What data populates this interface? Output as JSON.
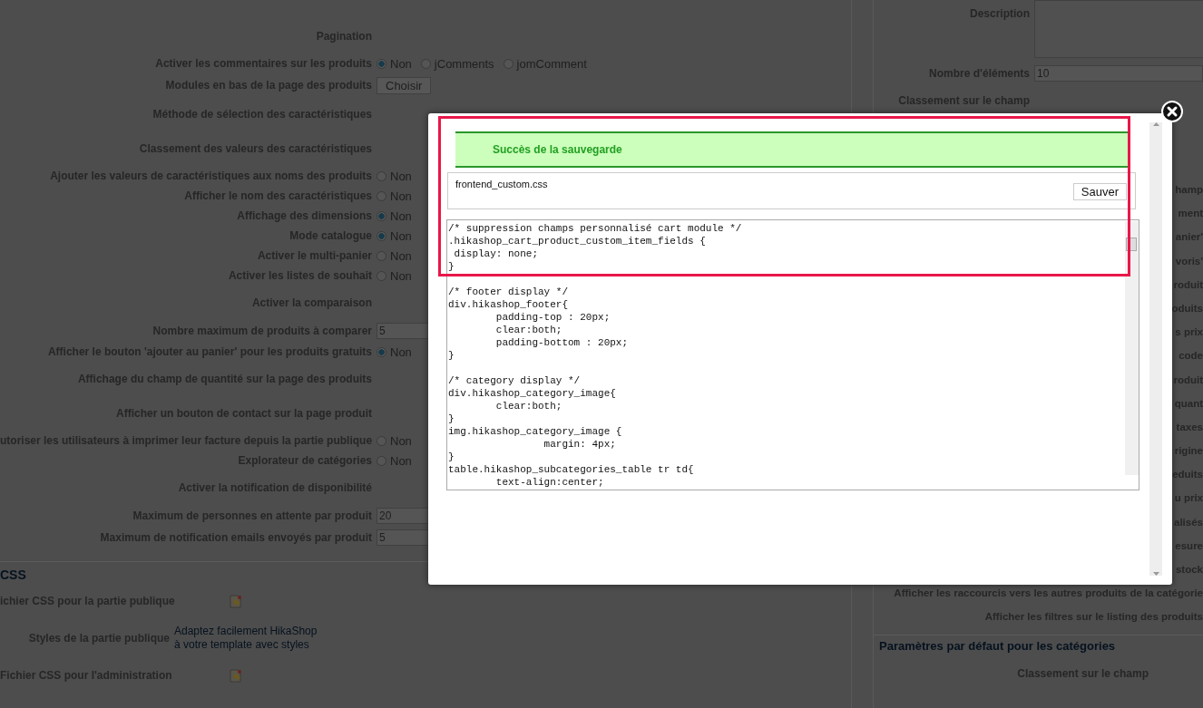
{
  "settings_left": {
    "rows": [
      {
        "label": "Pagination",
        "kind": "none"
      },
      {
        "label": "Activer les commentaires sur les produits",
        "kind": "radio",
        "options": [
          {
            "label": "Non",
            "selected": true
          },
          {
            "label": "jComments",
            "selected": false
          },
          {
            "label": "jomComment",
            "selected": false
          }
        ]
      },
      {
        "label": "Modules en bas de la page des produits",
        "kind": "button",
        "button": "Choisir"
      },
      {
        "label": "Méthode de sélection des caractéristiques",
        "kind": "none"
      },
      {
        "label": "Classement des valeurs des caractéristiques",
        "kind": "none"
      },
      {
        "label": "Ajouter les valeurs de caractéristiques aux noms des produits",
        "kind": "radio",
        "options": [
          {
            "label": "Non",
            "selected": false
          }
        ]
      },
      {
        "label": "Afficher le nom des caractéristiques",
        "kind": "radio",
        "options": [
          {
            "label": "Non",
            "selected": false
          }
        ]
      },
      {
        "label": "Affichage des dimensions",
        "kind": "radio",
        "options": [
          {
            "label": "Non",
            "selected": true
          }
        ]
      },
      {
        "label": "Mode catalogue",
        "kind": "radio",
        "options": [
          {
            "label": "Non",
            "selected": true
          }
        ]
      },
      {
        "label": "Activer le multi-panier",
        "kind": "radio",
        "options": [
          {
            "label": "Non",
            "selected": false
          }
        ]
      },
      {
        "label": "Activer les listes de souhait",
        "kind": "radio",
        "options": [
          {
            "label": "Non",
            "selected": false
          }
        ]
      },
      {
        "label": "Activer la comparaison",
        "kind": "none"
      },
      {
        "label": "Nombre maximum de produits à comparer",
        "kind": "input",
        "value": "5"
      },
      {
        "label": "Afficher le bouton 'ajouter au panier' pour les produits gratuits",
        "kind": "radio",
        "options": [
          {
            "label": "Non",
            "selected": true
          }
        ]
      },
      {
        "label": "Affichage du champ de quantité sur la page des produits",
        "kind": "none"
      },
      {
        "label": "Afficher un bouton de contact sur la page produit",
        "kind": "none"
      },
      {
        "label": "utoriser les utilisateurs à imprimer leur facture depuis la partie publique",
        "kind": "radio",
        "options": [
          {
            "label": "Non",
            "selected": false
          }
        ]
      },
      {
        "label": "Explorateur de catégories",
        "kind": "radio",
        "options": [
          {
            "label": "Non",
            "selected": false
          }
        ]
      },
      {
        "label": "Activer la notification de disponibilité",
        "kind": "none"
      },
      {
        "label": "Maximum de personnes en attente par produit",
        "kind": "input",
        "value": "20"
      },
      {
        "label": "Maximum de notification emails envoyés par produit",
        "kind": "input",
        "value": "5"
      }
    ]
  },
  "css_section": {
    "legend": "CSS",
    "rows": [
      {
        "label": "ichier CSS pour la partie publique",
        "kind": "file_icon"
      },
      {
        "label": "Styles de la partie publique",
        "kind": "link",
        "link_lines": [
          "Adaptez facilement HikaShop",
          "à votre template avec styles"
        ]
      },
      {
        "label": "Fichier CSS pour l'administration",
        "kind": "file_icon"
      }
    ]
  },
  "settings_right": {
    "rows": [
      {
        "label": "Description",
        "kind": "textarea"
      },
      {
        "label": "Nombre d'éléments",
        "kind": "input",
        "value": "10"
      },
      {
        "label": "Classement sur le champ",
        "kind": "none"
      }
    ],
    "labels": [
      "hamp",
      "ment",
      "anier'",
      "voris'",
      "roduit",
      "oduits",
      "s prix",
      "code",
      "roduit",
      "quant",
      "taxes",
      "rigine",
      "eduits",
      "u prix",
      "alisés",
      "esure",
      "stock",
      "Afficher les raccourcis vers les autres produits de la catégorie",
      "Afficher les filtres sur le listing des produits"
    ],
    "legend": "Paramètres par défaut pour les catégories",
    "category_rows": [
      {
        "label": "Classement sur le champ"
      }
    ]
  },
  "modal": {
    "success": "Succès de la sauvegarde",
    "file_name": "frontend_custom.css",
    "save_button": "Sauver",
    "code": "/* suppression champs personnalisé cart module */\n.hikashop_cart_product_custom_item_fields {\n display: none;\n}\n\n/* footer display */\ndiv.hikashop_footer{\n        padding-top : 20px;\n        clear:both;\n        padding-bottom : 20px;\n}\n\n/* category display */\ndiv.hikashop_category_image{\n        clear:both;\n}\nimg.hikashop_category_image {\n                margin: 4px;\n}\ntable.hikashop_subcategories_table tr td{\n        text-align:center;"
  }
}
